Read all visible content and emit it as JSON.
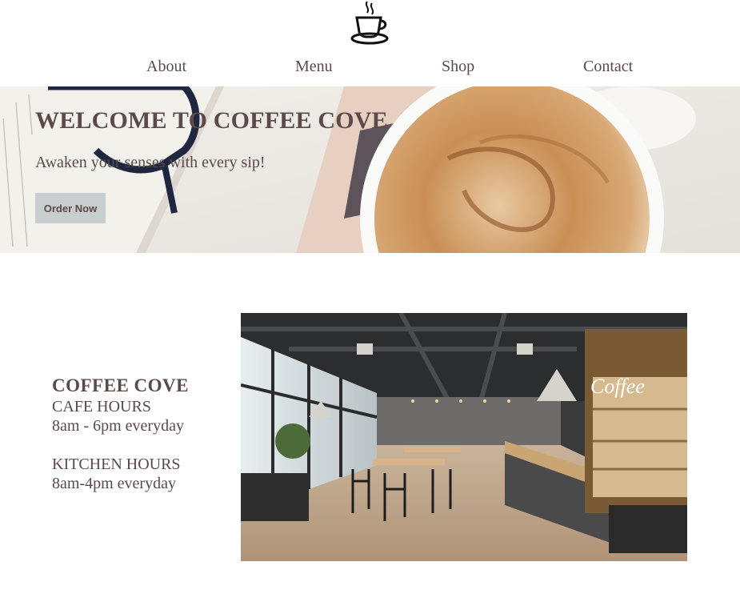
{
  "header": {
    "logo_icon": "coffee-cup-icon",
    "nav": [
      {
        "label": "About"
      },
      {
        "label": "Menu"
      },
      {
        "label": "Shop"
      },
      {
        "label": "Contact"
      }
    ]
  },
  "hero": {
    "title": "WELCOME TO COFFEE COVE",
    "subtitle": "Awaken your senses with every sip!",
    "button_label": "Order Now",
    "image": "coffee-latte-glasses-book-photo"
  },
  "info": {
    "name": "COFFEE COVE",
    "cafe_hours_label": "CAFE HOURS",
    "cafe_hours": "8am - 6pm everyday",
    "kitchen_hours_label": "KITCHEN HOURS",
    "kitchen_hours": "8am-4pm everyday"
  },
  "cafe_image": {
    "image": "cafe-interior-photo",
    "sign_text": "Coffee"
  },
  "colors": {
    "text": "#5a4a48",
    "button_bg": "#c8cdcd",
    "background": "#ffffff"
  }
}
